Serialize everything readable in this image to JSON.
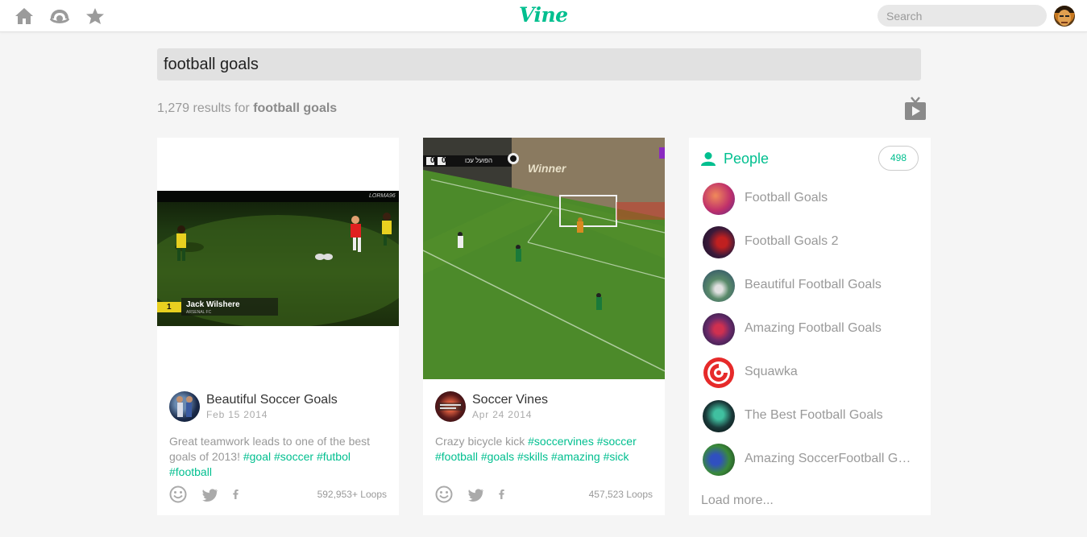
{
  "topbar": {
    "logo": "Vine",
    "search_placeholder": "Search"
  },
  "search": {
    "query": "football goals",
    "results_count": "1,279 results for",
    "results_term": "football goals"
  },
  "posts": [
    {
      "author": "Beautiful Soccer Goals",
      "date": "Feb 15 2014",
      "text": "Great teamwork leads to one of the best goals of 2013!",
      "tags": [
        "#goal",
        "#soccer",
        "#futbol",
        "#football"
      ],
      "loops": "592,953+ Loops",
      "overlay_name": "Jack Wilshere",
      "overlay_club": "ARSENAL FC",
      "overlay_number": "1",
      "overlay_watermark": "LORMA96"
    },
    {
      "author": "Soccer Vines",
      "date": "Apr 24 2014",
      "text": "Crazy bicycle kick",
      "tags": [
        "#soccervines",
        "#soccer",
        "#football",
        "#goals",
        "#skills",
        "#amazing",
        "#sick"
      ],
      "loops": "457,523 Loops",
      "score_home": "0",
      "score_away": "0",
      "score_team": "הפועל עכו",
      "banner_text": "Winner"
    }
  ],
  "people": {
    "title": "People",
    "count": "498",
    "items": [
      {
        "name": "Football Goals"
      },
      {
        "name": "Football Goals 2"
      },
      {
        "name": "Beautiful Football Goals"
      },
      {
        "name": "Amazing Football Goals"
      },
      {
        "name": "Squawka"
      },
      {
        "name": "The Best Football Goals"
      },
      {
        "name": "Amazing SoccerFootball Goals"
      }
    ],
    "load_more": "Load more..."
  },
  "colors": {
    "accent": "#00bf8f",
    "background": "#f5f5f5",
    "muted_text": "#999999"
  },
  "icons": [
    "home-icon",
    "popular-icon",
    "favorites-icon",
    "tv-icon",
    "person-icon",
    "smiley-icon",
    "twitter-icon",
    "facebook-icon"
  ]
}
